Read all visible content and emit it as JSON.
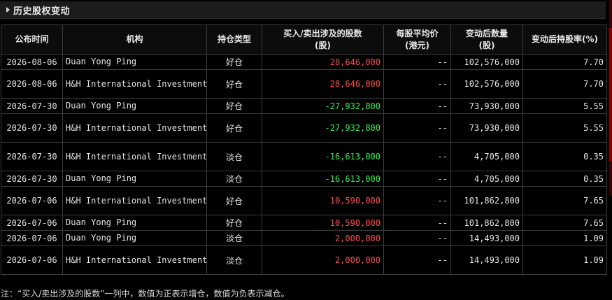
{
  "panel": {
    "title": "历史股权变动"
  },
  "colors": {
    "increase": "#ff4d4d",
    "decrease": "#33ee55",
    "background": "#000000",
    "border": "#3c3c3c"
  },
  "table": {
    "headers": {
      "date": "公布时间",
      "org": "机构",
      "type": "持仓类型",
      "change_l1": "买入/卖出涉及的股数",
      "change_l2": "(股)",
      "price_l1": "每股平均价",
      "price_l2": "(港元)",
      "qty_l1": "变动后数量",
      "qty_l2": "(股)",
      "ratio": "变动后持股率(%)"
    },
    "rows": [
      {
        "date": "2026-08-06",
        "org": "Duan Yong Ping",
        "type": "好仓",
        "change": "28,646,000",
        "price": "--",
        "qty": "102,576,000",
        "ratio": "7.70"
      },
      {
        "date": "2026-08-06",
        "org": "H&H International Investment, LLC",
        "type": "好仓",
        "change": "28,646,000",
        "price": "--",
        "qty": "102,576,000",
        "ratio": "7.70"
      },
      {
        "date": "2026-07-30",
        "org": "Duan Yong Ping",
        "type": "好仓",
        "change": "-27,932,800",
        "price": "--",
        "qty": "73,930,000",
        "ratio": "5.55"
      },
      {
        "date": "2026-07-30",
        "org": "H&H International Investment, LLC",
        "type": "好仓",
        "change": "-27,932,800",
        "price": "--",
        "qty": "73,930,000",
        "ratio": "5.55"
      },
      {
        "date": "2026-07-30",
        "org": "H&H International Investment, LLC",
        "type": "淡仓",
        "change": "-16,613,000",
        "price": "--",
        "qty": "4,705,000",
        "ratio": "0.35"
      },
      {
        "date": "2026-07-30",
        "org": "Duan Yong Ping",
        "type": "淡仓",
        "change": "-16,613,000",
        "price": "--",
        "qty": "4,705,000",
        "ratio": "0.35"
      },
      {
        "date": "2026-07-06",
        "org": "H&H International Investment, LLC",
        "type": "好仓",
        "change": "10,590,000",
        "price": "--",
        "qty": "101,862,800",
        "ratio": "7.65"
      },
      {
        "date": "2026-07-06",
        "org": "Duan Yong Ping",
        "type": "好仓",
        "change": "10,590,000",
        "price": "--",
        "qty": "101,862,800",
        "ratio": "7.65"
      },
      {
        "date": "2026-07-06",
        "org": "Duan Yong Ping",
        "type": "淡仓",
        "change": "2,000,000",
        "price": "--",
        "qty": "14,493,000",
        "ratio": "1.09"
      },
      {
        "date": "2026-07-06",
        "org": "H&H International Investment, LLC",
        "type": "淡仓",
        "change": "2,000,000",
        "price": "--",
        "qty": "14,493,000",
        "ratio": "1.09"
      }
    ]
  },
  "footnote": "注：“买入/卖出涉及的股数”一列中，数值为正表示增仓，数值为负表示减仓。"
}
